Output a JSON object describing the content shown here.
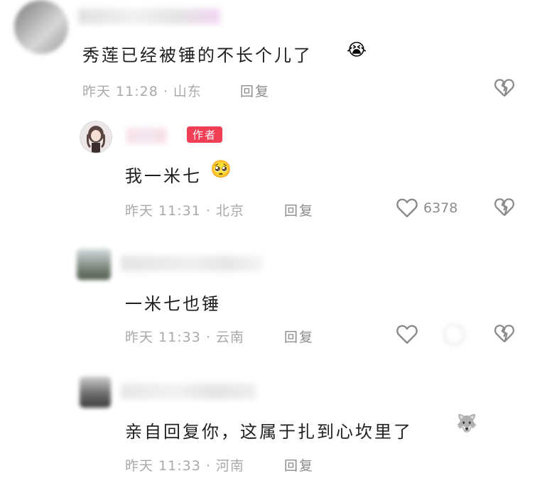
{
  "comments": [
    {
      "text": "秀莲已经被锤的不长个儿了",
      "emoji": "😭",
      "meta": "昨天 11:28 · 山东",
      "reply": "回复"
    },
    {
      "badge": "作者",
      "text": "我一米七",
      "emoji": "🥺",
      "meta": "昨天 11:31 · 北京",
      "reply": "回复",
      "likes": "6378"
    },
    {
      "text": "一米七也锤",
      "meta": "昨天 11:33 · 云南",
      "reply": "回复"
    },
    {
      "text": "亲自回复你，这属于扎到心坎里了",
      "emoji": "🐺",
      "meta": "昨天 11:33 · 河南",
      "reply": "回复"
    }
  ],
  "icons": {
    "dislike": "broken-heart-icon",
    "like": "heart-outline-icon"
  },
  "colors": {
    "badge": "#f03e55",
    "meta_text": "#a9a9a9",
    "body_text": "#202020"
  }
}
